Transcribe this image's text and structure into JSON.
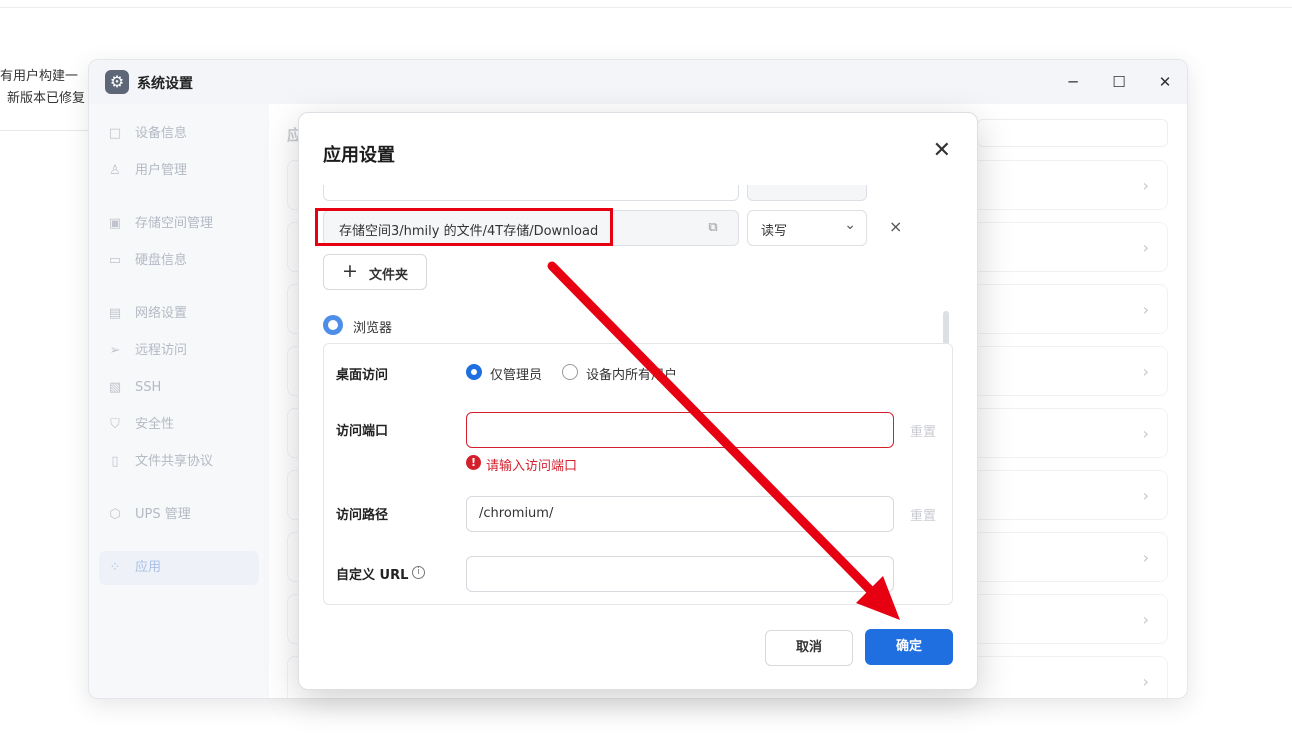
{
  "background": {
    "notice_line1": "有用户构建一",
    "notice_line2": "新版本已修复"
  },
  "window": {
    "title": "系统设置",
    "app_icon": "gear-icon",
    "controls": {
      "minimize": "─",
      "maximize": "☐",
      "close": "✕"
    }
  },
  "sidebar": {
    "items": [
      {
        "label": "设备信息",
        "icon": "□"
      },
      {
        "label": "用户管理",
        "icon": "♙"
      },
      {
        "label": "存储空间管理",
        "icon": "▣"
      },
      {
        "label": "硬盘信息",
        "icon": "▭"
      },
      {
        "label": "网络设置",
        "icon": "▤"
      },
      {
        "label": "远程访问",
        "icon": "➢"
      },
      {
        "label": "SSH",
        "icon": "▧"
      },
      {
        "label": "安全性",
        "icon": "⛉"
      },
      {
        "label": "文件共享协议",
        "icon": "▯"
      },
      {
        "label": "UPS 管理",
        "icon": "⬡"
      },
      {
        "label": "应用",
        "icon": "⁘"
      }
    ]
  },
  "main": {
    "heading": "应"
  },
  "dialog": {
    "title": "应用设置",
    "close": "✕",
    "folder_row": {
      "path": "存储空间3/hmily 的文件/4T存储/Download",
      "permission": "读写",
      "delete": "×"
    },
    "add_folder_label": "文件夹",
    "browser": {
      "label": "浏览器",
      "desktop_access": {
        "label": "桌面访问",
        "options": [
          "仅管理员",
          "设备内所有用户"
        ],
        "selected": "仅管理员"
      },
      "access_port": {
        "label": "访问端口",
        "value": "",
        "reset": "重置",
        "error": "请输入访问端口"
      },
      "access_path": {
        "label": "访问路径",
        "value": "/chromium/",
        "reset": "重置"
      },
      "custom_url": {
        "label": "自定义 URL",
        "value": ""
      }
    },
    "cancel_label": "取消",
    "ok_label": "确定"
  },
  "colors": {
    "accent": "#1f6fe0",
    "error": "#d4202c",
    "annotation": "#e60012"
  }
}
